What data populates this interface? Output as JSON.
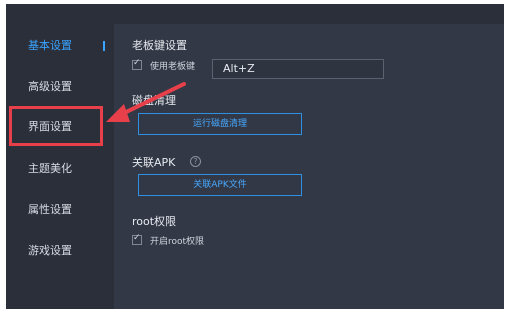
{
  "sidebar": {
    "items": [
      {
        "label": "基本设置",
        "active": true
      },
      {
        "label": "高级设置",
        "active": false
      },
      {
        "label": "界面设置",
        "active": false
      },
      {
        "label": "主题美化",
        "active": false
      },
      {
        "label": "属性设置",
        "active": false
      },
      {
        "label": "游戏设置",
        "active": false
      }
    ]
  },
  "boss_key": {
    "title": "老板键设置",
    "checkbox_label": "使用老板键",
    "checked": true,
    "hotkey_value": "Alt+Z"
  },
  "disk_cleanup": {
    "title": "磁盘清理",
    "button_label": "运行磁盘清理"
  },
  "apk": {
    "title": "关联APK",
    "help_symbol": "?",
    "button_label": "关联APK文件"
  },
  "root": {
    "title": "root权限",
    "checkbox_label": "开启root权限",
    "checked": true
  },
  "colors": {
    "accent": "#3aa4ff",
    "highlight": "#e8404a",
    "background": "#2b2f3a"
  }
}
